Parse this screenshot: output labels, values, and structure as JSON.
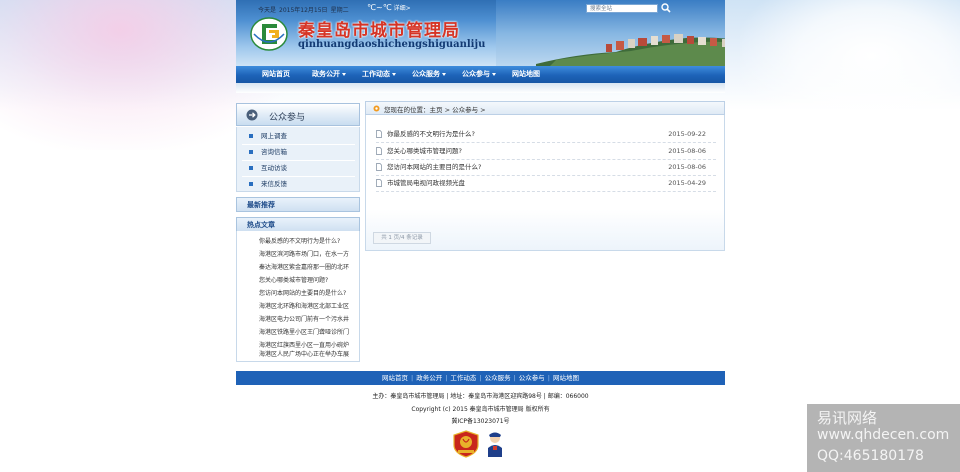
{
  "colors": {
    "nav_blue": "#1d63b8",
    "logo_red": "#d63425",
    "footer_blue": "#1f62b7",
    "side_bg": "#e9f1f9"
  },
  "header": {
    "date_label": "今天是",
    "date": "2015年12月15日",
    "weekday": "星期二",
    "weather": "℃~℃",
    "weather_detail": "详细>",
    "search_placeholder": "搜索全站",
    "logo_icon": "cg-logo-icon",
    "site_name": "秦皇岛市城市管理局",
    "site_name_pinyin": "qinhuangdaoshichengshiguanliju"
  },
  "nav": {
    "items": [
      {
        "label": "网站首页",
        "dropdown": false
      },
      {
        "label": "政务公开",
        "dropdown": true
      },
      {
        "label": "工作动态",
        "dropdown": true
      },
      {
        "label": "公众服务",
        "dropdown": true
      },
      {
        "label": "公众参与",
        "dropdown": true
      },
      {
        "label": "网站地图",
        "dropdown": false
      }
    ]
  },
  "sidebar": {
    "title": "公众参与",
    "menu": [
      "网上调查",
      "咨询信箱",
      "互动访谈",
      "来信反馈"
    ],
    "recommend_title": "最新推荐",
    "hot_title": "热点文章",
    "hot_items": [
      "你最反感的不文明行为是什么?",
      "海港区滨河路市场门口，在水一方",
      "秦达海港区紫金嘉府那一圈的北环",
      "您关心哪类城市管理问题?",
      "您访问本网站的主要目的是什么?",
      "海港区北环路和海港区北部工业区",
      "海港区电力公司门前有一个污水井",
      "海港区铁路里小区王门聋哑诊所门",
      "海港区红旗西里小区一直用小碗炉",
      "海港区人民广场中心正在举办车展"
    ]
  },
  "breadcrumb": {
    "text": "您现在的位置：主页 > 公众参与 >"
  },
  "articles": [
    {
      "title": "你最反感的不文明行为是什么?",
      "date": "2015-09-22"
    },
    {
      "title": "您关心哪类城市管理问题?",
      "date": "2015-08-06"
    },
    {
      "title": "您访问本网站的主要目的是什么?",
      "date": "2015-08-06"
    },
    {
      "title": "市城管局电视问政视频光盘",
      "date": "2015-04-29"
    }
  ],
  "pager": {
    "text": "共 1 页/4 条记录"
  },
  "footer": {
    "nav": [
      "网站首页",
      "政务公开",
      "工作动态",
      "公众服务",
      "公众参与",
      "网站地图"
    ],
    "line1": "主办：秦皇岛市城市管理局 | 地址：秦皇岛市海港区迎宾路98号 | 邮编：066000",
    "line2": "Copyright (c) 2015 秦皇岛市城市管理局 版权所有",
    "line3": "冀ICP备13023071号",
    "badge1_icon": "party-government-badge-icon",
    "badge2_icon": "police-badge-icon"
  },
  "watermark": {
    "name": "易讯网络",
    "url": "www.qhdecen.com",
    "qq": "QQ:465180178"
  }
}
